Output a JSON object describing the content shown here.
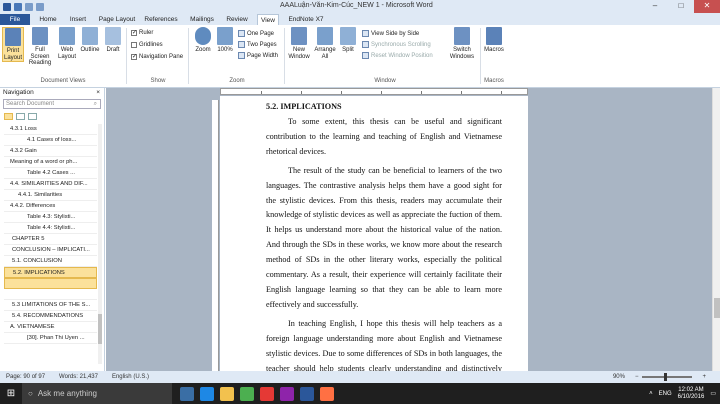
{
  "window": {
    "title": "AAALuận-Văn-Kim-Cúc_NEW 1 - Microsoft Word",
    "minimize": "–",
    "maximize": "□",
    "close": "✕"
  },
  "tabs": [
    "File",
    "Home",
    "Insert",
    "Page Layout",
    "References",
    "Mailings",
    "Review",
    "View",
    "EndNote X7"
  ],
  "active_tab": "View",
  "ribbon": {
    "document_views": {
      "label": "Document Views",
      "buttons": [
        "Print Layout",
        "Full Screen Reading",
        "Web Layout",
        "Outline",
        "Draft"
      ]
    },
    "show": {
      "label": "Show",
      "checks": [
        {
          "label": "Ruler",
          "checked": true
        },
        {
          "label": "Gridlines",
          "checked": false
        },
        {
          "label": "Navigation Pane",
          "checked": true
        }
      ]
    },
    "zoom": {
      "label": "Zoom",
      "zoom_btn": "Zoom",
      "hundred_btn": "100%",
      "one_page": "One Page",
      "two_pages": "Two Pages",
      "page_width": "Page Width"
    },
    "window": {
      "label": "Window",
      "new_window": "New Window",
      "arrange_all": "Arrange All",
      "split": "Split",
      "side_by_side": "View Side by Side",
      "sync_scroll": "Synchronous Scrolling",
      "reset_pos": "Reset Window Position",
      "switch_windows": "Switch Windows"
    },
    "macros": {
      "label": "Macros",
      "macros_btn": "Macros"
    }
  },
  "nav": {
    "title": "Navigation",
    "close": "×",
    "search_placeholder": "Search Document",
    "items": [
      "4.3.1 Loss",
      "4.1 Cases of loss...",
      "4.3.2 Gain",
      "Meaning of a word or ph...",
      "Table 4.2 Cases ...",
      "4.4. SIMILARITIES AND DIF...",
      "4.4.1. Similarities",
      "4.4.2. Differences",
      "Table 4.3: Stylisti...",
      "Table 4.4: Stylisti...",
      "CHAPTER 5",
      "CONCLUSION – IMPLICATI...",
      "5.1. CONCLUSION",
      "5.2. IMPLICATIONS",
      "",
      "",
      "5.3 LIMITATIONS OF THE S...",
      "5.4. RECOMMENDATIONS",
      "A. VIETNAMESE",
      "[30]. Phan Thi Uyen ..."
    ],
    "selected_index": 13
  },
  "document": {
    "heading": "5.2. IMPLICATIONS",
    "paragraphs": [
      "To some extent, this thesis can be useful and significant contribution to the learning and teaching of English and Vietnamese rhetorical devices.",
      "The result of the study can be beneficial to learners of the two languages. The contrastive analysis helps them have a good sight for the stylistic devices. From this thesis, readers may accumulate their knowledge of stylistic devices as well as appreciate the fuction of them. It helps us understand more about the historical value of the nation. And through the SDs in these works, we know more about the research method of SDs in the other literary works, especially the political commentary. As a result, their experience will certainly facilitate their English language learning so that they can be able to learn more effectively and successfully.",
      "In teaching English, I hope this thesis will help teachers as a foreign language understanding more about English and Vietnamese stylistic devices. Due to some differences of SDs in both languages, the teacher should help students clearly understanding and distinctively distinguish English and Vietnamese stylistic devices when they study."
    ]
  },
  "status": {
    "page": "Page: 90 of 97",
    "words": "Words: 21,437",
    "language": "English (U.S.)",
    "zoom": "90%"
  },
  "taskbar": {
    "ask": "Ask me anything",
    "lang": "ENG",
    "time": "12:02 AM",
    "date": "6/10/2016"
  },
  "colors": {
    "accent": "#2b579a",
    "highlight": "#fbe19b",
    "chrome": "#dfe9f5"
  }
}
